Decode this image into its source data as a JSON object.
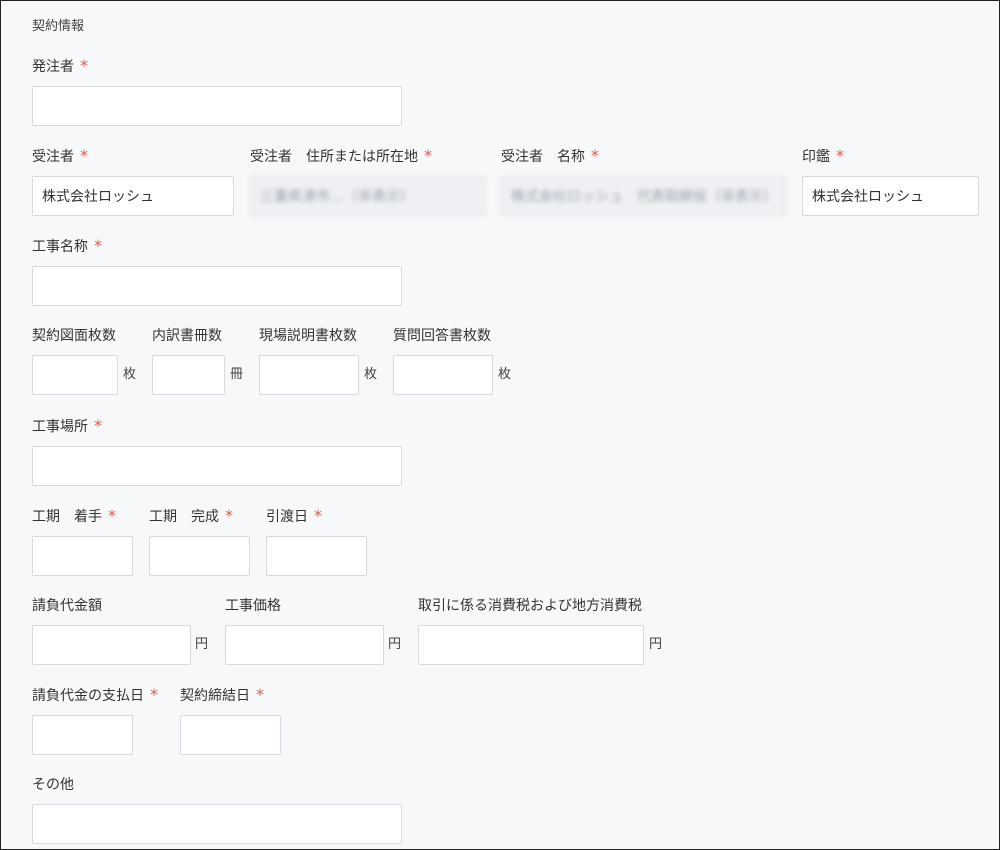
{
  "section": {
    "title": "契約情報"
  },
  "fields": {
    "orderer": {
      "label": "発注者",
      "required": "*",
      "value": ""
    },
    "contractor": {
      "label": "受注者",
      "required": "*",
      "value": "株式会社ロッシュ"
    },
    "contractor_address": {
      "label": "受注者　住所または所在地",
      "required": "*",
      "value": "三重県津市…（非表示）"
    },
    "contractor_name": {
      "label": "受注者　名称",
      "required": "*",
      "value": "株式会社ロッシュ　代表取締役（非表示）"
    },
    "seal": {
      "label": "印鑑",
      "required": "*",
      "value": "株式会社ロッシュ"
    },
    "project_name": {
      "label": "工事名称",
      "required": "*",
      "value": ""
    },
    "contract_drawings": {
      "label": "契約図面枚数",
      "unit": "枚",
      "value": ""
    },
    "breakdown_books": {
      "label": "内訳書冊数",
      "unit": "冊",
      "value": ""
    },
    "site_explanation": {
      "label": "現場説明書枚数",
      "unit": "枚",
      "value": ""
    },
    "qa_sheets": {
      "label": "質問回答書枚数",
      "unit": "枚",
      "value": ""
    },
    "site_location": {
      "label": "工事場所",
      "required": "*",
      "value": ""
    },
    "period_start": {
      "label": "工期　着手",
      "required": "*",
      "value": ""
    },
    "period_end": {
      "label": "工期　完成",
      "required": "*",
      "value": ""
    },
    "delivery_date": {
      "label": "引渡日",
      "required": "*",
      "value": ""
    },
    "contract_amount": {
      "label": "請負代金額",
      "unit": "円",
      "value": ""
    },
    "construction_price": {
      "label": "工事価格",
      "unit": "円",
      "value": ""
    },
    "tax": {
      "label": "取引に係る消費税および地方消費税",
      "unit": "円",
      "value": ""
    },
    "payment_date": {
      "label": "請負代金の支払日",
      "required": "*",
      "value": ""
    },
    "contract_date": {
      "label": "契約締結日",
      "required": "*",
      "value": ""
    },
    "other": {
      "label": "その他",
      "value": ""
    }
  }
}
